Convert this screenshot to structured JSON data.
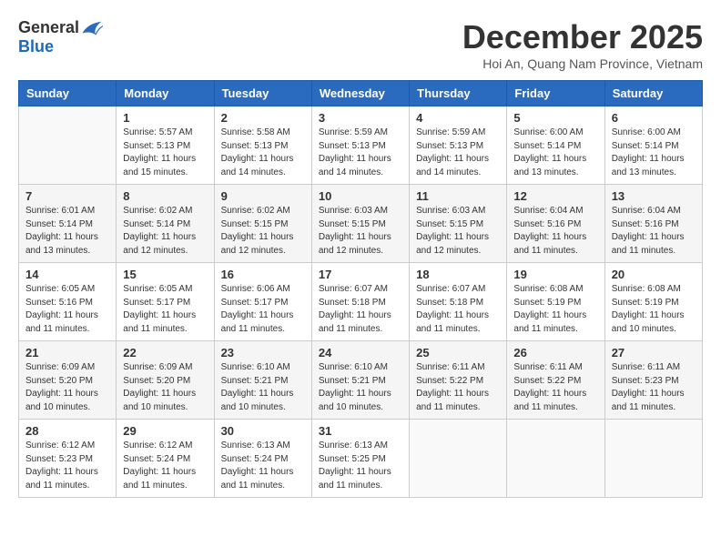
{
  "logo": {
    "general": "General",
    "blue": "Blue"
  },
  "header": {
    "month": "December 2025",
    "location": "Hoi An, Quang Nam Province, Vietnam"
  },
  "weekdays": [
    "Sunday",
    "Monday",
    "Tuesday",
    "Wednesday",
    "Thursday",
    "Friday",
    "Saturday"
  ],
  "weeks": [
    [
      {
        "day": "",
        "info": ""
      },
      {
        "day": "1",
        "info": "Sunrise: 5:57 AM\nSunset: 5:13 PM\nDaylight: 11 hours\nand 15 minutes."
      },
      {
        "day": "2",
        "info": "Sunrise: 5:58 AM\nSunset: 5:13 PM\nDaylight: 11 hours\nand 14 minutes."
      },
      {
        "day": "3",
        "info": "Sunrise: 5:59 AM\nSunset: 5:13 PM\nDaylight: 11 hours\nand 14 minutes."
      },
      {
        "day": "4",
        "info": "Sunrise: 5:59 AM\nSunset: 5:13 PM\nDaylight: 11 hours\nand 14 minutes."
      },
      {
        "day": "5",
        "info": "Sunrise: 6:00 AM\nSunset: 5:14 PM\nDaylight: 11 hours\nand 13 minutes."
      },
      {
        "day": "6",
        "info": "Sunrise: 6:00 AM\nSunset: 5:14 PM\nDaylight: 11 hours\nand 13 minutes."
      }
    ],
    [
      {
        "day": "7",
        "info": "Sunrise: 6:01 AM\nSunset: 5:14 PM\nDaylight: 11 hours\nand 13 minutes."
      },
      {
        "day": "8",
        "info": "Sunrise: 6:02 AM\nSunset: 5:14 PM\nDaylight: 11 hours\nand 12 minutes."
      },
      {
        "day": "9",
        "info": "Sunrise: 6:02 AM\nSunset: 5:15 PM\nDaylight: 11 hours\nand 12 minutes."
      },
      {
        "day": "10",
        "info": "Sunrise: 6:03 AM\nSunset: 5:15 PM\nDaylight: 11 hours\nand 12 minutes."
      },
      {
        "day": "11",
        "info": "Sunrise: 6:03 AM\nSunset: 5:15 PM\nDaylight: 11 hours\nand 12 minutes."
      },
      {
        "day": "12",
        "info": "Sunrise: 6:04 AM\nSunset: 5:16 PM\nDaylight: 11 hours\nand 11 minutes."
      },
      {
        "day": "13",
        "info": "Sunrise: 6:04 AM\nSunset: 5:16 PM\nDaylight: 11 hours\nand 11 minutes."
      }
    ],
    [
      {
        "day": "14",
        "info": "Sunrise: 6:05 AM\nSunset: 5:16 PM\nDaylight: 11 hours\nand 11 minutes."
      },
      {
        "day": "15",
        "info": "Sunrise: 6:05 AM\nSunset: 5:17 PM\nDaylight: 11 hours\nand 11 minutes."
      },
      {
        "day": "16",
        "info": "Sunrise: 6:06 AM\nSunset: 5:17 PM\nDaylight: 11 hours\nand 11 minutes."
      },
      {
        "day": "17",
        "info": "Sunrise: 6:07 AM\nSunset: 5:18 PM\nDaylight: 11 hours\nand 11 minutes."
      },
      {
        "day": "18",
        "info": "Sunrise: 6:07 AM\nSunset: 5:18 PM\nDaylight: 11 hours\nand 11 minutes."
      },
      {
        "day": "19",
        "info": "Sunrise: 6:08 AM\nSunset: 5:19 PM\nDaylight: 11 hours\nand 11 minutes."
      },
      {
        "day": "20",
        "info": "Sunrise: 6:08 AM\nSunset: 5:19 PM\nDaylight: 11 hours\nand 10 minutes."
      }
    ],
    [
      {
        "day": "21",
        "info": "Sunrise: 6:09 AM\nSunset: 5:20 PM\nDaylight: 11 hours\nand 10 minutes."
      },
      {
        "day": "22",
        "info": "Sunrise: 6:09 AM\nSunset: 5:20 PM\nDaylight: 11 hours\nand 10 minutes."
      },
      {
        "day": "23",
        "info": "Sunrise: 6:10 AM\nSunset: 5:21 PM\nDaylight: 11 hours\nand 10 minutes."
      },
      {
        "day": "24",
        "info": "Sunrise: 6:10 AM\nSunset: 5:21 PM\nDaylight: 11 hours\nand 10 minutes."
      },
      {
        "day": "25",
        "info": "Sunrise: 6:11 AM\nSunset: 5:22 PM\nDaylight: 11 hours\nand 11 minutes."
      },
      {
        "day": "26",
        "info": "Sunrise: 6:11 AM\nSunset: 5:22 PM\nDaylight: 11 hours\nand 11 minutes."
      },
      {
        "day": "27",
        "info": "Sunrise: 6:11 AM\nSunset: 5:23 PM\nDaylight: 11 hours\nand 11 minutes."
      }
    ],
    [
      {
        "day": "28",
        "info": "Sunrise: 6:12 AM\nSunset: 5:23 PM\nDaylight: 11 hours\nand 11 minutes."
      },
      {
        "day": "29",
        "info": "Sunrise: 6:12 AM\nSunset: 5:24 PM\nDaylight: 11 hours\nand 11 minutes."
      },
      {
        "day": "30",
        "info": "Sunrise: 6:13 AM\nSunset: 5:24 PM\nDaylight: 11 hours\nand 11 minutes."
      },
      {
        "day": "31",
        "info": "Sunrise: 6:13 AM\nSunset: 5:25 PM\nDaylight: 11 hours\nand 11 minutes."
      },
      {
        "day": "",
        "info": ""
      },
      {
        "day": "",
        "info": ""
      },
      {
        "day": "",
        "info": ""
      }
    ]
  ]
}
